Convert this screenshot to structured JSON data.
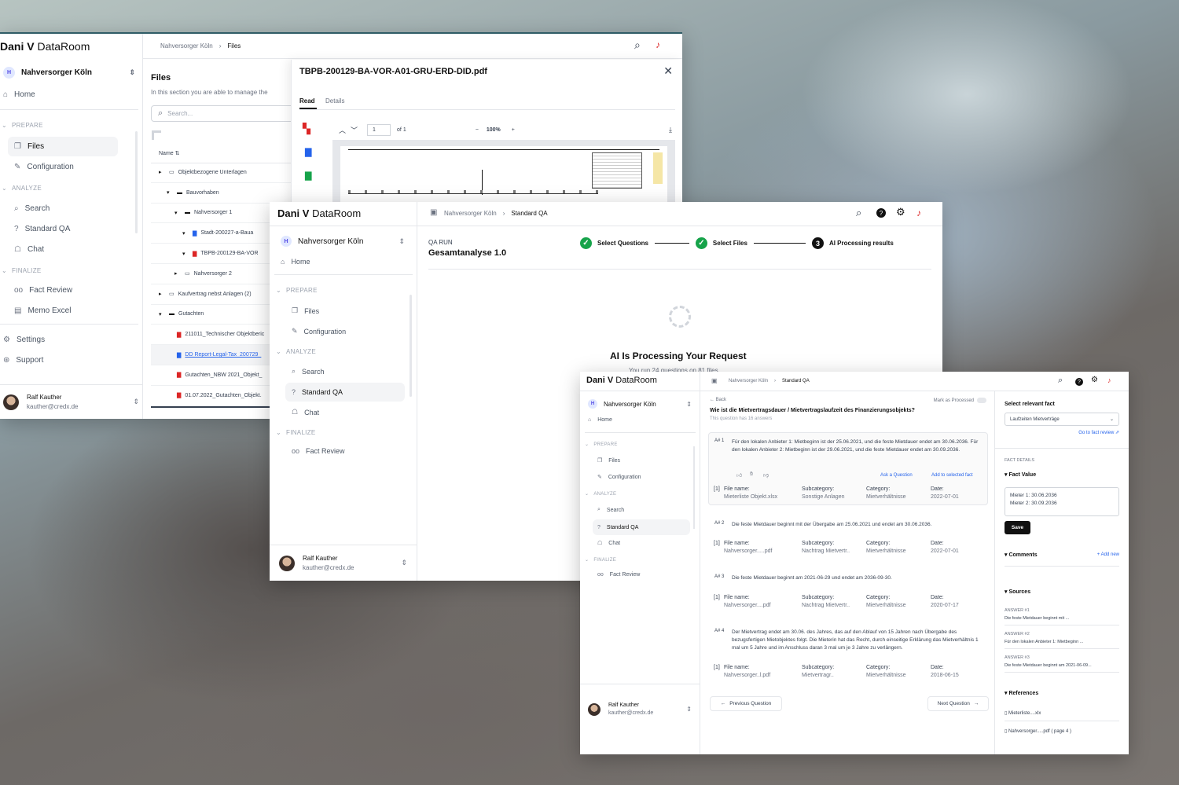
{
  "brand": {
    "bold": "Dani V",
    "rest": " DataRoom"
  },
  "workspace": {
    "initial": "H",
    "name": "Nahversorger Köln"
  },
  "user": {
    "name": "Ralf Kauther",
    "email": "kauther@credx.de"
  },
  "nav": {
    "home": "Home",
    "prepare": "PREPARE",
    "files": "Files",
    "configuration": "Configuration",
    "analyze": "ANALYZE",
    "search": "Search",
    "standard_qa": "Standard QA",
    "chat": "Chat",
    "finalize": "FINALIZE",
    "fact_review": "Fact Review",
    "memo_excel": "Memo Excel",
    "settings": "Settings",
    "support": "Support"
  },
  "win1": {
    "breadcrumb": [
      "Nahversorger Köln",
      "Files"
    ],
    "title": "Files",
    "desc": "In this section you are able to manage the",
    "search_placeholder": "Search...",
    "col_name": "Name",
    "tree": [
      {
        "label": "Objektbezogene Unterlagen",
        "type": "folder"
      },
      {
        "label": "Bauvorhaben",
        "type": "folder-open"
      },
      {
        "label": "Nahversorger 1",
        "type": "folder-open"
      },
      {
        "label": "Stadt-200227-a-Baua",
        "type": "doc"
      },
      {
        "label": "TBPB-200129-BA-VOR",
        "type": "pdf"
      },
      {
        "label": "Nahversorger 2",
        "type": "folder"
      },
      {
        "label": "Kaufvertrag nebst Anlagen (2)",
        "type": "folder"
      },
      {
        "label": "Gutachten",
        "type": "folder-open"
      },
      {
        "label": "211011_Technischer Objektberic",
        "type": "pdf"
      },
      {
        "label": "DD Report-Legal-Tax_200729_",
        "type": "doc"
      },
      {
        "label": "Gutachten_NBW 2021_Objekt_",
        "type": "pdf"
      },
      {
        "label": "01.07.2022_Gutachten_Objekt.",
        "type": "pdf"
      }
    ],
    "viewer": {
      "filename": "TBPB-200129-BA-VOR-A01-GRU-ERD-DID.pdf",
      "tab_read": "Read",
      "tab_details": "Details",
      "page": "1",
      "of": "of 1",
      "zoom": "100%"
    }
  },
  "win2": {
    "breadcrumb": [
      "Nahversorger Köln",
      "Standard QA"
    ],
    "run_label": "QA RUN",
    "run_name": "Gesamtanalyse 1.0",
    "steps": [
      "Select Questions",
      "Select Files",
      "AI Processing results"
    ],
    "step3_num": "3",
    "processing_title": "AI Is Processing Your Request",
    "processing_sub": "You run 24 questions on 81 files"
  },
  "win3": {
    "breadcrumb": [
      "Nahversorger Köln",
      "Standard QA"
    ],
    "back": "Back",
    "mark_processed": "Mark as Processed",
    "question": "Wie ist die Mietvertragsdauer / Mietvertragslaufzeit des Finanzierungsobjekts?",
    "answer_count": "This question has 16 answers",
    "labels": {
      "file": "File name:",
      "subcategory": "Subcategory:",
      "category": "Category:",
      "date": "Date:"
    },
    "ask_question": "Ask a Question",
    "add_fact": "Add to selected fact",
    "answers": [
      {
        "num": "A# 1",
        "text": "Für den lokalen Anbieter 1: Mietbeginn ist der 25.06.2021, und die feste Mietdauer endet am 30.06.2036. Für den lokalen Anbieter 2: Mietbeginn ist der 29.06.2021, und die feste Mietdauer endet am 30.09.2036.",
        "ref": "[1]",
        "file": "Mieterliste Objekt.xlsx",
        "subcategory": "Sonstige Anlagen",
        "category": "Mietverhältnisse",
        "date": "2022-07-01"
      },
      {
        "num": "A# 2",
        "text": "Die feste Mietdauer beginnt mit der Übergabe am 25.06.2021 und endet am 30.06.2036.",
        "ref": "[1]",
        "file": "Nahversorger.....pdf",
        "subcategory": "Nachtrag Mietvertr..",
        "category": "Mietverhältnisse",
        "date": "2022-07-01"
      },
      {
        "num": "A# 3",
        "text": "Die feste Mietdauer beginnt am 2021-06-29 und endet am 2036-09-30.",
        "ref": "[1]",
        "file": "Nahversorger....pdf",
        "subcategory": "Nachtrag Mietvertr..",
        "category": "Mietverhältnisse",
        "date": "2020-07-17"
      },
      {
        "num": "A# 4",
        "text": "Der Mietvertrag endet am 30.06. des Jahres, das auf den Ablauf von 15 Jahren nach Übergabe des bezugsfertigen Mietobjektes folgt. Die Mieterin hat das Recht, durch einseitige Erklärung das Mietverhältnis 1 mal um 5 Jahre und im Anschluss daran 3 mal um je 3 Jahre zu verlängern.",
        "ref": "[1]",
        "file": "Nahversorger..l.pdf",
        "subcategory": "Mietvertragr..",
        "category": "Mietverhältnisse",
        "date": "2018-06-15"
      }
    ],
    "prev": "Previous Question",
    "next": "Next Question",
    "panel": {
      "title": "Select relevant fact",
      "select_value": "Laufzeiten Mietverträge",
      "go_fact": "Go to fact review",
      "fact_details": "FACT DETAILS",
      "fact_value": "Fact Value",
      "fact_lines": [
        "Mieter 1: 30.06.2036",
        "Mieter 2: 30.09.2036"
      ],
      "save": "Save",
      "comments": "Comments",
      "add_new": "+ Add new",
      "sources": "Sources",
      "source_items": [
        {
          "label": "ANSWER #1",
          "text": "Die feste Mietdauer beginnt mit ..."
        },
        {
          "label": "ANSWER #2",
          "text": "Für den lokalen Anbieter 1: Mietbeginn ..."
        },
        {
          "label": "ANSWER #3",
          "text": "Die feste Mietdauer beginnt am 2021-06-09..."
        }
      ],
      "references": "References",
      "ref_items": [
        "Mieterliste....xlx",
        "Nahversorger.....pdf ( page 4 )"
      ]
    }
  }
}
